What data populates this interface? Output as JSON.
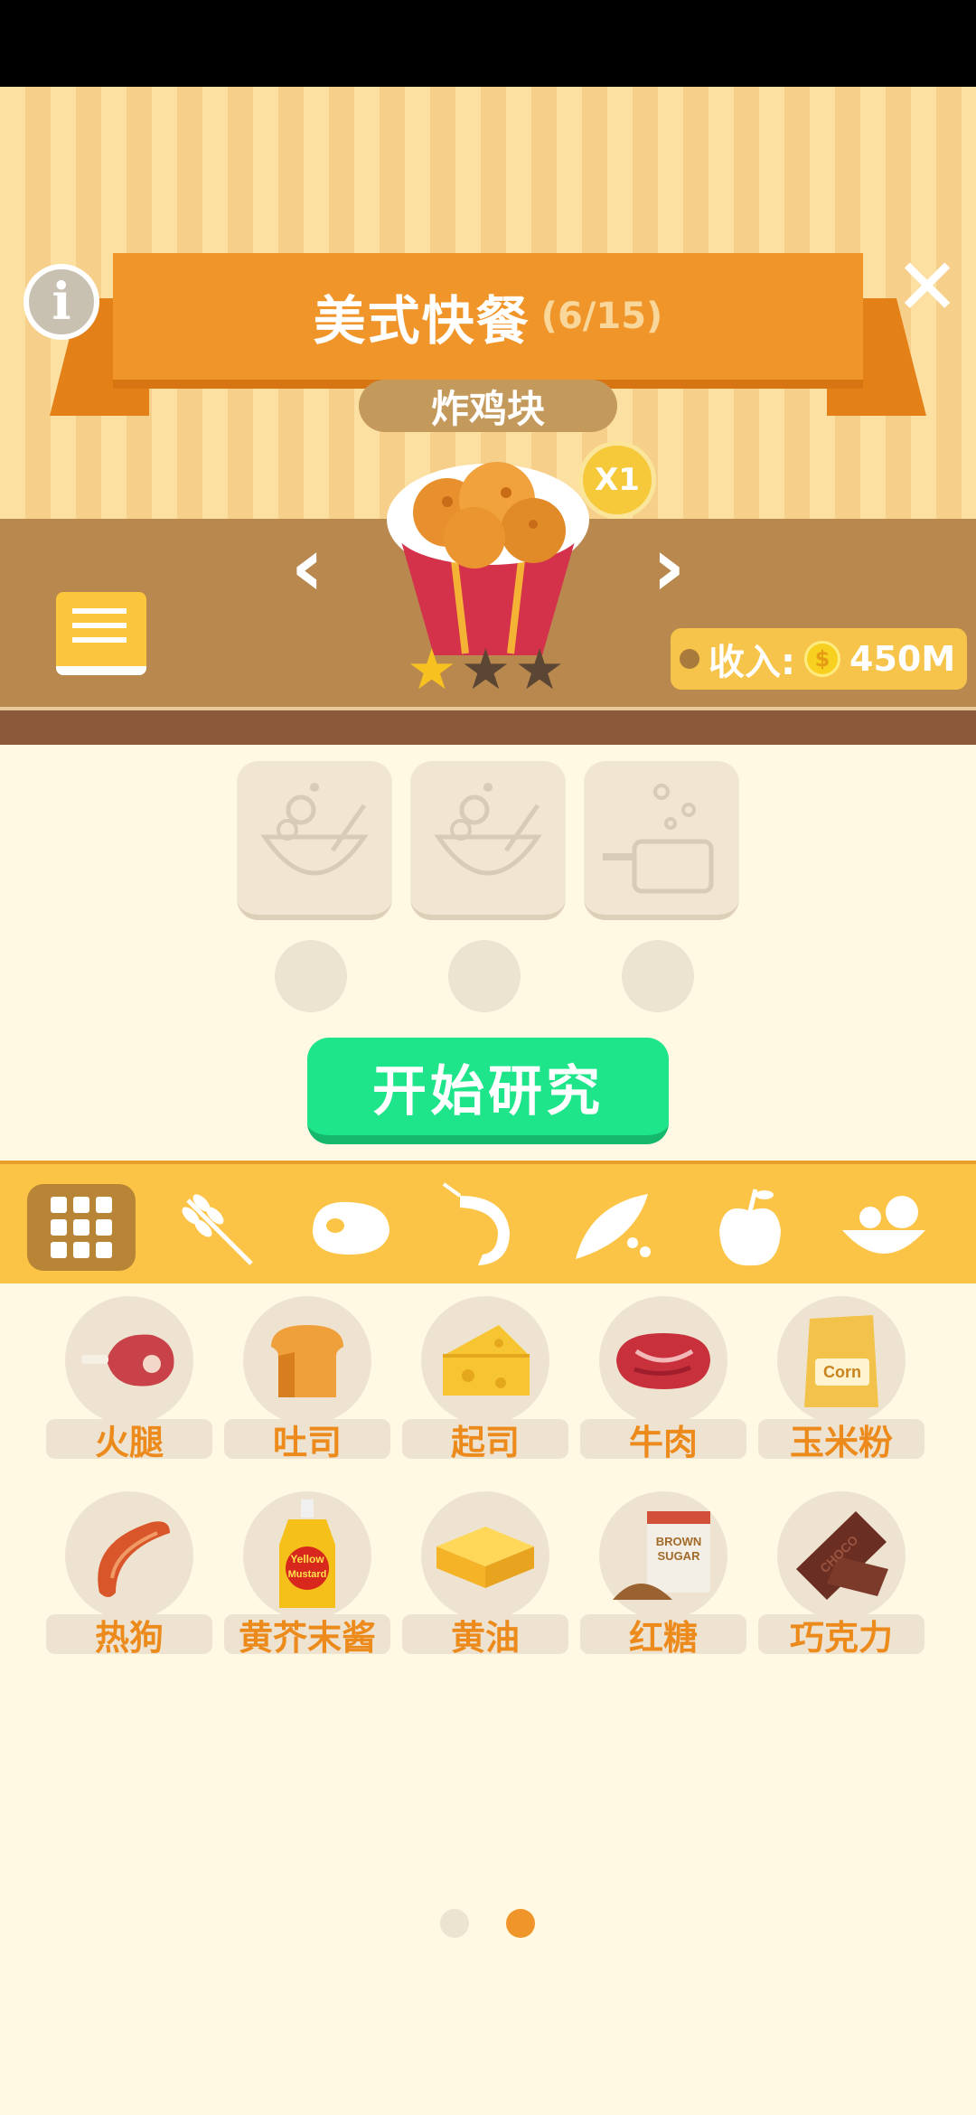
{
  "header": {
    "title": "美式快餐",
    "progress": "(6/15)",
    "dish_name": "炸鸡块",
    "level": "X1",
    "stars": [
      true,
      false,
      false
    ],
    "income_label": "收入:",
    "income_value": "450M",
    "info_glyph": "i",
    "close_glyph": "✕",
    "prev_glyph": "‹",
    "next_glyph": "›"
  },
  "research": {
    "slots": [
      "mixing-bowl-icon",
      "mixing-bowl-icon",
      "pot-icon"
    ],
    "start_label": "开始研究"
  },
  "categories": [
    {
      "icon": "grid-icon",
      "active": true
    },
    {
      "icon": "wheat-icon",
      "active": false
    },
    {
      "icon": "meat-icon",
      "active": false
    },
    {
      "icon": "shrimp-icon",
      "active": false
    },
    {
      "icon": "peas-icon",
      "active": false
    },
    {
      "icon": "apple-icon",
      "active": false
    },
    {
      "icon": "salad-bowl-icon",
      "active": false
    }
  ],
  "ingredients": [
    {
      "name": "火腿",
      "icon": "ham-icon"
    },
    {
      "name": "吐司",
      "icon": "toast-icon"
    },
    {
      "name": "起司",
      "icon": "cheese-icon"
    },
    {
      "name": "牛肉",
      "icon": "beef-icon"
    },
    {
      "name": "玉米粉",
      "icon": "cornmeal-icon",
      "label_text": "Corn"
    },
    {
      "name": "热狗",
      "icon": "sausage-icon"
    },
    {
      "name": "黄芥末酱",
      "icon": "mustard-icon",
      "label_text": "Yellow Mustard"
    },
    {
      "name": "黄油",
      "icon": "butter-icon"
    },
    {
      "name": "红糖",
      "icon": "brown-sugar-icon",
      "label_text": "BROWN SUGAR"
    },
    {
      "name": "巧克力",
      "icon": "chocolate-icon",
      "label_text": "CHOCO"
    }
  ],
  "pagination": {
    "pages": 2,
    "current": 2
  },
  "colors": {
    "accent": "#f0952a",
    "start": "#1ee48a",
    "star_on": "#f7c21f",
    "star_off": "#5b4633"
  }
}
